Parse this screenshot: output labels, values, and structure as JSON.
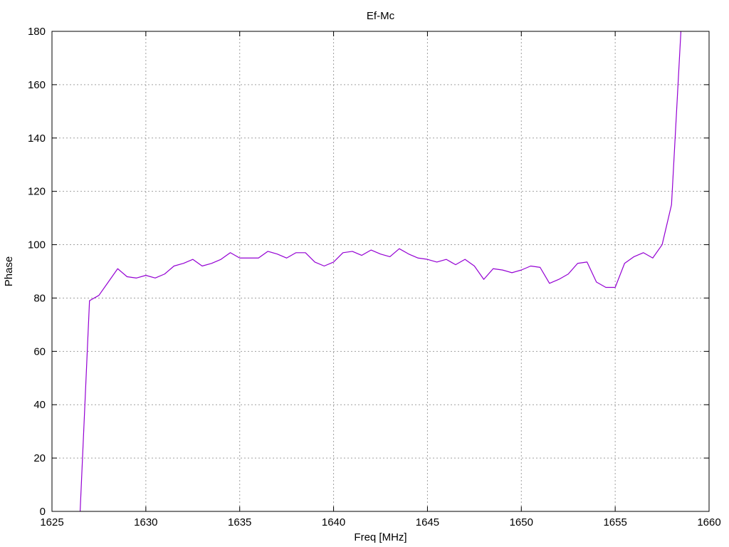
{
  "chart_data": {
    "type": "line",
    "title": "Ef-Mc",
    "xlabel": "Freq [MHz]",
    "ylabel": "Phase",
    "xlim": [
      1625,
      1660
    ],
    "ylim": [
      0,
      180
    ],
    "xticks": [
      1625,
      1630,
      1635,
      1640,
      1645,
      1650,
      1655,
      1660
    ],
    "yticks": [
      0,
      20,
      40,
      60,
      80,
      100,
      120,
      140,
      160,
      180
    ],
    "grid": true,
    "legend": "none",
    "series": [
      {
        "color": "#9400d3",
        "x": [
          1626.5,
          1627.0,
          1627.5,
          1628.0,
          1628.5,
          1629.0,
          1629.5,
          1630.0,
          1630.5,
          1631.0,
          1631.5,
          1632.0,
          1632.5,
          1633.0,
          1633.5,
          1634.0,
          1634.5,
          1635.0,
          1635.5,
          1636.0,
          1636.5,
          1637.0,
          1637.5,
          1638.0,
          1638.5,
          1639.0,
          1639.5,
          1640.0,
          1640.5,
          1641.0,
          1641.5,
          1642.0,
          1642.5,
          1643.0,
          1643.5,
          1644.0,
          1644.5,
          1645.0,
          1645.5,
          1646.0,
          1646.5,
          1647.0,
          1647.5,
          1648.0,
          1648.5,
          1649.0,
          1649.5,
          1650.0,
          1650.5,
          1651.0,
          1651.5,
          1652.0,
          1652.5,
          1653.0,
          1653.5,
          1654.0,
          1654.5,
          1655.0,
          1655.5,
          1656.0,
          1656.5,
          1657.0,
          1657.5,
          1658.0,
          1658.5
        ],
        "y": [
          0,
          79,
          81,
          86,
          91,
          88,
          87.5,
          88.5,
          87.5,
          89,
          92,
          93,
          94.5,
          92,
          93,
          94.5,
          97,
          95,
          95,
          95,
          97.5,
          96.5,
          95,
          97,
          97,
          93.5,
          92,
          93.5,
          97,
          97.5,
          96,
          98,
          96.5,
          95.5,
          98.5,
          96.5,
          95,
          94.5,
          93.5,
          94.5,
          92.5,
          94.5,
          92,
          87,
          91,
          90.5,
          89.5,
          90.5,
          92,
          91.5,
          85.5,
          87,
          89,
          93,
          93.5,
          86,
          84,
          84,
          93,
          95.5,
          97,
          95,
          100,
          115,
          180
        ]
      }
    ]
  }
}
